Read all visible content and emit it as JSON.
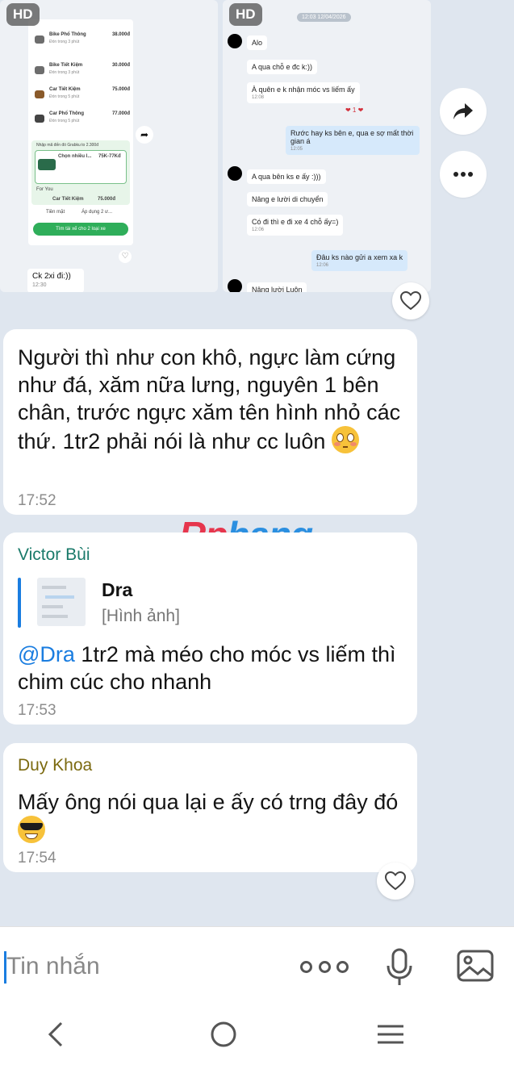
{
  "attachments": {
    "hd_label": "HD",
    "left_shot": {
      "rides": [
        {
          "name": "Bike Phổ Thông",
          "price": "38.000đ",
          "eta": "Đón trong 3 phút"
        },
        {
          "name": "Bike Tiết Kiệm",
          "price": "30.000đ",
          "eta": "Đón trong 3 phút"
        },
        {
          "name": "Car Tiết Kiệm",
          "price": "75.000đ",
          "eta": "Đón trong 5 phút"
        },
        {
          "name": "Car Phổ Thông",
          "price": "77.000đ",
          "eta": "Đón trong 5 phút"
        }
      ],
      "promo_note": "Nhập mã đến đó Grabku to 2.300đ",
      "promo_choice": "Chọn nhiều l...",
      "promo_price": "75K-77Kđ",
      "for_you": "For You",
      "for_you_item": "Car Tiết Kiệm",
      "for_you_price": "75.000đ",
      "payment": "Tiền mặt",
      "apply": "Áp dụng 2 ư...",
      "cta": "Tìm tài xế cho 2 loại xe"
    },
    "ck_message": "Ck 2xi đi:))",
    "ck_time": "12:30",
    "right_shot": {
      "date": "12:03 12/04/2026",
      "messages": [
        {
          "text": "Alo",
          "time": "",
          "mine": false
        },
        {
          "text": "A qua chỗ e đc k:))",
          "time": "",
          "mine": false
        },
        {
          "text": "À quên e k nhận móc vs liếm ấy",
          "time": "12:08",
          "mine": false
        },
        {
          "text": "Rước hay ks bên e, qua e sợ mất thời gian á",
          "time": "12:05",
          "mine": true
        },
        {
          "text": "A qua bên ks e ấy :)))",
          "time": "",
          "mine": false
        },
        {
          "text": "Nâng e lười di chuyển",
          "time": "",
          "mine": false
        },
        {
          "text": "Có đi thì e đi xe 4 chỗ ấy=)",
          "time": "12:06",
          "mine": false
        },
        {
          "text": "Đâu ks nào gửi a xem xa k",
          "time": "12:06",
          "mine": true
        },
        {
          "text": "Nâng lười Luôn",
          "time": "",
          "mine": false
        }
      ]
    }
  },
  "messages": [
    {
      "sender": "",
      "text": "Người thì như con khô, ngực làm cứng như đá, xăm nữa lưng, nguyên 1 bên chân, trước ngực xăm tên hình nhỏ các thứ. 1tr2 phải nói là như cc luôn",
      "emoji": "flushed-face",
      "time": "17:52"
    },
    {
      "sender": "Victor Bùi",
      "sender_color": "#1a7a6a",
      "quote": {
        "name": "Dra",
        "type": "[Hình ảnh]"
      },
      "mention": "@Dra",
      "text": " 1tr2 mà méo cho móc vs liếm thì chim cúc cho nhanh",
      "time": "17:53"
    },
    {
      "sender": "Duy Khoa",
      "sender_color": "#7c6a10",
      "text": "Mấy ông nói qua lại e ấy có trng đây đó",
      "emoji": "sunglasses-face",
      "time": "17:54"
    }
  ],
  "watermark": {
    "part1": "Rp",
    "part2": "hang"
  },
  "composer": {
    "placeholder": "Tin nhắn"
  },
  "colors": {
    "accent": "#1a7de0",
    "bubble": "#ffffff",
    "background": "#dfe6ef"
  }
}
